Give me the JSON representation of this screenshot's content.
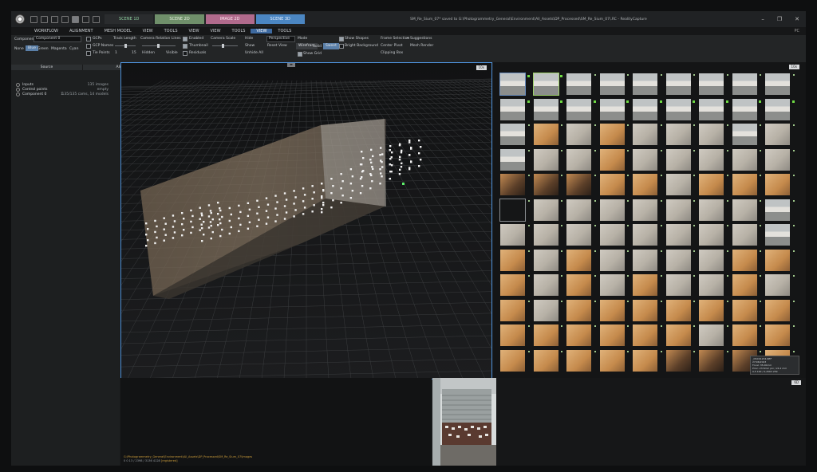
{
  "titlebar": {
    "scene_tabs": [
      "SCENE 1D",
      "SCENE 2D",
      "IMAGE 2D",
      "SCENE 3D"
    ],
    "title": "SM_Re_Sium_07* saved to G:\\Photogrammetry_General\\Environment\\All_Assets\\DP_Processed\\SM_Re_Sium_07\\.RC - RealityCapture"
  },
  "menubar": {
    "items": [
      "WORKFLOW",
      "ALIGNMENT",
      "MESH MODEL",
      "VIEW",
      "TOOLS",
      "VIEW",
      "VIEW",
      "TOOLS",
      "VIEW",
      "TOOLS"
    ],
    "right": "PC"
  },
  "ribbon": {
    "source": {
      "component_label": "Component",
      "component_value": "Component 0",
      "color_buttons": [
        "None",
        "Blue",
        "Green",
        "Magenta",
        "Cyan"
      ],
      "selected_color": "Blue",
      "group_title": "Source"
    },
    "alignment_points": {
      "gcps": "GCPs",
      "gcp_names": "GCP Names",
      "tie_points": "Tie Points",
      "track_length": "Track Length",
      "track_min": "1",
      "track_max": "15",
      "camera_relation_lines": "Camera Relation Lines",
      "hidden": "Hidden",
      "visible": "Visible",
      "group_title": "Alignment Points"
    },
    "alignment_cameras": {
      "enabled": "Enabled",
      "thumbnail": "Thumbnail",
      "residuals": "Residuals",
      "camera_scale": "Camera Scale",
      "group_title": "Alignment Cameras"
    },
    "view_camera": {
      "hide": "Hide",
      "show": "Show",
      "unhide_all": "Unhide All",
      "projection": "Perspective",
      "reset_view": "Reset View",
      "group_title": "View Camera"
    },
    "scene_render": {
      "mode_label": "Mode",
      "modes": [
        "Wirefram",
        "Solid",
        "Sweet"
      ],
      "selected_mode": "Sweet",
      "show_shapes": "Show Shapes",
      "bright_background": "Bright Background",
      "show_grid": "Show Grid",
      "group_title": "Scene Render"
    },
    "view_tools": {
      "frame_selection": "Frame Selection",
      "suggestions": "Suggestions",
      "center_pivot": "Center Pivot",
      "mesh_render": "Mesh Render",
      "clipping_box": "Clipping Box",
      "group_title": "View Tools"
    }
  },
  "leftpanel": {
    "rows": [
      {
        "label": "Inputs",
        "num": "",
        "value": "135 images"
      },
      {
        "label": "Control points",
        "num": "",
        "value": "empty"
      },
      {
        "label": "Component 0",
        "num": "1",
        "value": "135/135 cams, 14 models"
      }
    ]
  },
  "view3d": {
    "badge": "10x"
  },
  "imagepanel": {
    "badge": "10x"
  },
  "tooltip": {
    "lines": [
      "_DSC01234.NEF",
      "27/06/2023",
      "Focal: 35.00mm",
      "Prior: 23.5mm pix / 24.2 mm",
      "0,5 100 / 0,2563 259"
    ]
  },
  "bottom": {
    "path_line1": "G:\\Photogrammetry_General\\Environment\\All_Assets\\DP_Processed\\SM_Re_Sium_07\\Images",
    "path_line2": "0 0 13 / 2398 / 3136 4128",
    "path_status": "[registered]",
    "right_badge": "6D"
  },
  "colors": {
    "accent_blue": "#4d8fd6",
    "menu_active": "#3e6aa0",
    "marker_green": "#6fdc44",
    "path_orange": "#c89a3a"
  },
  "thumbnails": {
    "columns": 9,
    "rows": 12,
    "types": [
      "w",
      "w",
      "w",
      "w",
      "w",
      "w",
      "w",
      "w",
      "w",
      "w",
      "w",
      "w",
      "w",
      "w",
      "w",
      "w",
      "w",
      "w",
      "w",
      "o",
      "g",
      "o",
      "g",
      "g",
      "g",
      "w",
      "g",
      "w",
      "g",
      "g",
      "o",
      "g",
      "g",
      "g",
      "g",
      "g",
      "d",
      "d",
      "d",
      "o",
      "o",
      "g",
      "o",
      "o",
      "o",
      "e",
      "g",
      "g",
      "g",
      "g",
      "g",
      "g",
      "g",
      "w",
      "g",
      "g",
      "g",
      "g",
      "g",
      "g",
      "g",
      "g",
      "w",
      "o",
      "g",
      "o",
      "g",
      "g",
      "g",
      "g",
      "o",
      "o",
      "o",
      "g",
      "o",
      "g",
      "o",
      "g",
      "g",
      "o",
      "g",
      "o",
      "g",
      "o",
      "o",
      "o",
      "o",
      "o",
      "o",
      "o",
      "o",
      "o",
      "o",
      "o",
      "o",
      "o",
      "g",
      "o",
      "o",
      "o",
      "o",
      "o",
      "o",
      "o",
      "d",
      "d",
      "d",
      "o"
    ],
    "selected_index": 1,
    "outlined_index": 0,
    "empty_index": 45,
    "green_marked": [
      0,
      1,
      9,
      10,
      11,
      12,
      13,
      14,
      15,
      16,
      17
    ]
  }
}
